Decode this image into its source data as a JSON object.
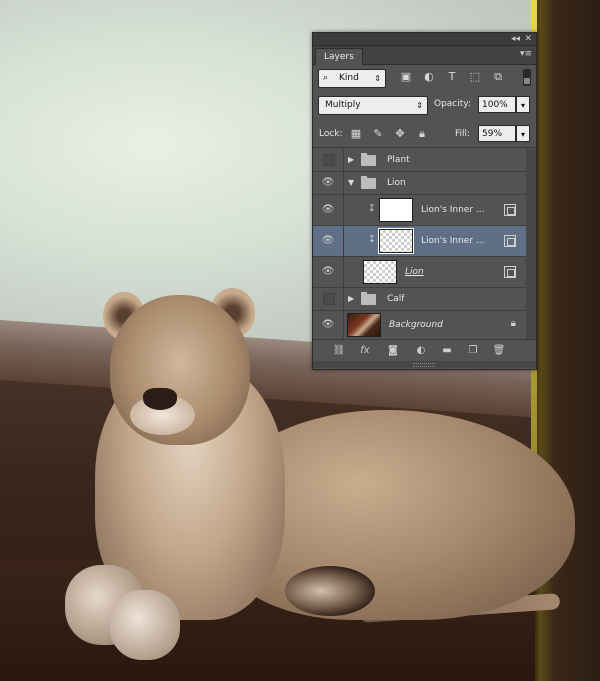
{
  "panel": {
    "collapse_glyph": "◂◂",
    "close_glyph": "✕",
    "tab_label": "Layers",
    "menu_glyph": "▾≡"
  },
  "filter": {
    "kind_label": "Kind",
    "icons": [
      "image-filter-icon",
      "adjustment-filter-icon",
      "type-filter-icon",
      "shape-filter-icon",
      "smart-object-filter-icon"
    ]
  },
  "blend": {
    "mode": "Multiply",
    "opacity_label": "Opacity:",
    "opacity_value": "100%"
  },
  "lock": {
    "label": "Lock:",
    "fill_label": "Fill:",
    "fill_value": "59%"
  },
  "layers": [
    {
      "name": "Plant",
      "type": "group",
      "visible": false,
      "expanded": false
    },
    {
      "name": "Lion",
      "type": "group",
      "visible": true,
      "expanded": true
    },
    {
      "name": "Lion's Inner ...",
      "type": "clipped",
      "visible": true,
      "selected": false
    },
    {
      "name": "Lion's Inner ...",
      "type": "clipped",
      "visible": true,
      "selected": true
    },
    {
      "name": "Lion",
      "type": "smart",
      "visible": true
    },
    {
      "name": "Calf",
      "type": "group",
      "visible": false,
      "expanded": false
    },
    {
      "name": "Background",
      "type": "background",
      "visible": true,
      "locked": true
    }
  ],
  "bottom_icons": [
    "link-layers-icon",
    "fx-icon",
    "add-mask-icon",
    "adjustment-layer-icon",
    "new-group-icon",
    "new-layer-icon",
    "delete-layer-icon"
  ],
  "bottom_glyphs": {
    "fx": "fx"
  }
}
